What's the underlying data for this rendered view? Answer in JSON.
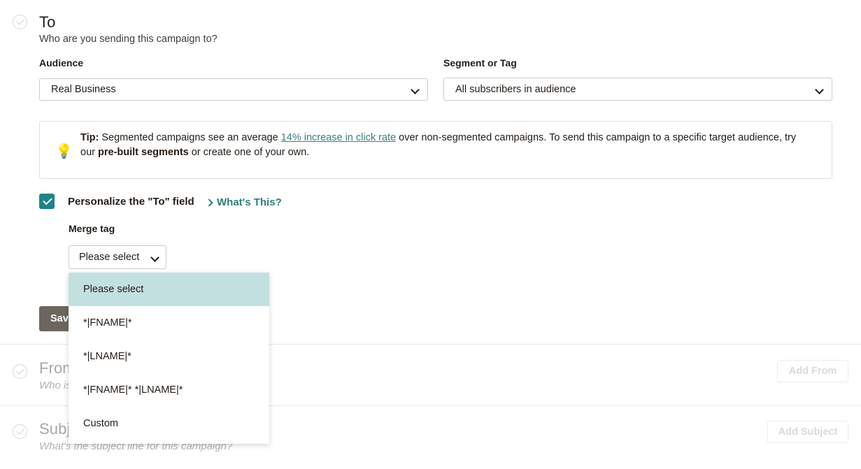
{
  "sections": {
    "to": {
      "title": "To",
      "subtitle": "Who are you sending this campaign to?",
      "audience_label": "Audience",
      "audience_value": "Real Business",
      "segment_label": "Segment or Tag",
      "segment_value": "All subscribers in audience",
      "save_label": "Save"
    },
    "from": {
      "title": "From",
      "subtitle": "Who is sending this campaign?",
      "action_label": "Add From"
    },
    "subject": {
      "title": "Subject",
      "subtitle": "What's the subject line for this campaign?",
      "action_label": "Add Subject"
    }
  },
  "tip": {
    "prefix": "Tip:",
    "text_before_link": " Segmented campaigns see an average ",
    "link_text": "14% increase in click rate",
    "text_after_link": " over non-segmented campaigns. To send this campaign to a specific target audience, try our ",
    "bold_text": "pre-built segments",
    "text_end": " or create one of your own."
  },
  "personalize": {
    "checkbox_label": "Personalize the \"To\" field",
    "checked": true,
    "whats_this_label": "What's This?",
    "merge_tag_label": "Merge tag",
    "merge_tag_value": "Please select"
  },
  "merge_tag_dropdown": {
    "open": true,
    "options": [
      {
        "label": "Please select",
        "selected": true
      },
      {
        "label": "*|FNAME|*",
        "selected": false
      },
      {
        "label": "*|LNAME|*",
        "selected": false
      },
      {
        "label": "*|FNAME|* *|LNAME|*",
        "selected": false
      },
      {
        "label": "Custom",
        "selected": false
      }
    ]
  },
  "icons": {
    "bulb": "Ὂ1",
    "check_circle": "check-circle-icon",
    "chevron": "chevron-down-icon"
  },
  "colors": {
    "accent_teal": "#1e8489",
    "link_teal": "#3b7f7e",
    "dropdown_highlight": "#c3e0e0",
    "save_button": "#6c665e",
    "bulb_yellow": "#f2d14f",
    "disabled_text": "#d9d9d9"
  }
}
